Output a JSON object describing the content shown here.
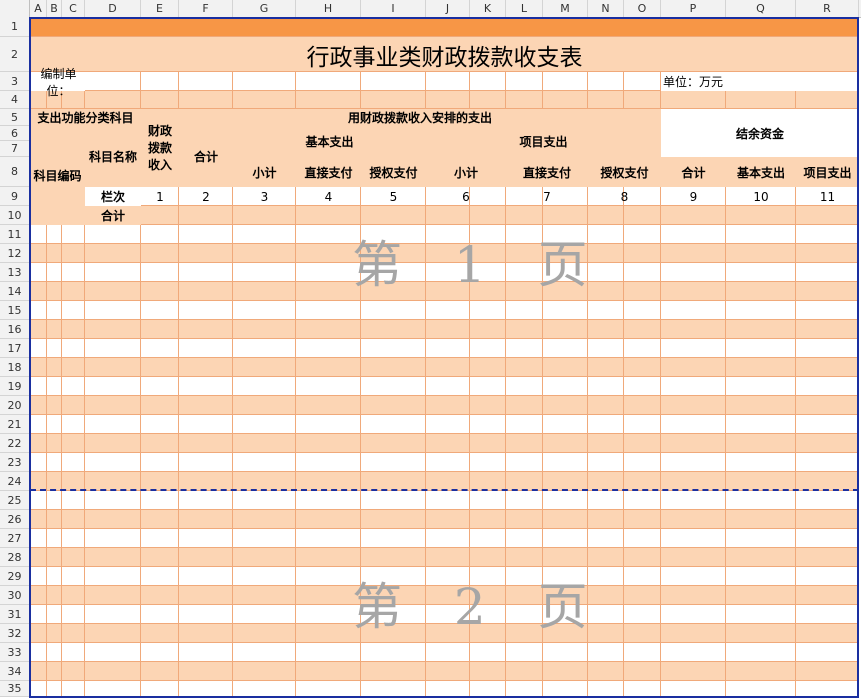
{
  "columns": [
    "A",
    "B",
    "C",
    "D",
    "E",
    "F",
    "G",
    "H",
    "I",
    "J",
    "K",
    "L",
    "M",
    "N",
    "O",
    "P",
    "Q",
    "R"
  ],
  "rows": [
    "1",
    "2",
    "3",
    "4",
    "5",
    "6",
    "7",
    "8",
    "9",
    "10",
    "11",
    "12",
    "13",
    "14",
    "15",
    "16",
    "17",
    "18",
    "19",
    "20",
    "21",
    "22",
    "23",
    "24",
    "25",
    "26",
    "27",
    "28",
    "29",
    "30",
    "31",
    "32",
    "33",
    "34",
    "35"
  ],
  "sheet": {
    "title": "行政事业类财政拨款收支表",
    "unit_left": "编制单位：",
    "unit_right": "单位：万元",
    "header": {
      "category": "支出功能分类科目",
      "code": "科目编码",
      "name": "科目名称",
      "income": "财政拨款收入",
      "spending_group": "用财政拨款收入安排的支出",
      "total": "合计",
      "basic": "基本支出",
      "project": "项目支出",
      "subtotal": "小计",
      "direct": "直接支付",
      "auth": "授权支付",
      "balance": "结余资金",
      "bal_total": "合计",
      "bal_basic": "基本支出",
      "bal_project": "项目支出"
    },
    "row9": {
      "label": "栏次",
      "nums": [
        "1",
        "2",
        "3",
        "4",
        "5",
        "6",
        "7",
        "8",
        "9",
        "10",
        "11"
      ]
    },
    "row10": {
      "label": "合计"
    },
    "watermark1": "第 1 页",
    "watermark2": "第 2 页"
  },
  "colors": {
    "accent_orange": "#f79646",
    "band_light": "#fcd5b4",
    "gridline": "#f0a97a",
    "pagebreak": "#1a2fa0"
  }
}
